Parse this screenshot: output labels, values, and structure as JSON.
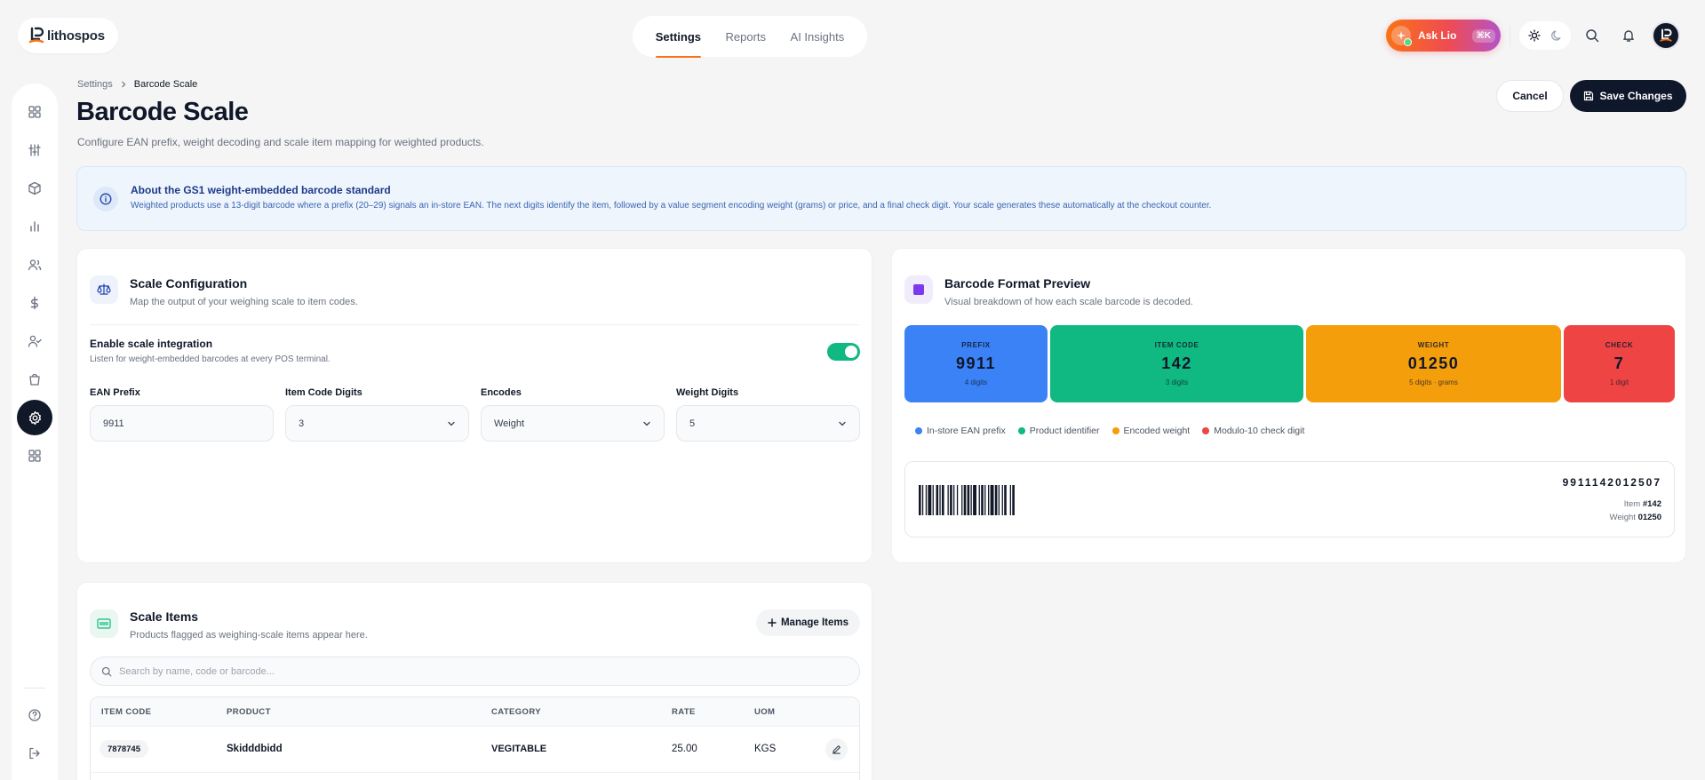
{
  "brand": {
    "name": "lithospos"
  },
  "topnav": {
    "tabs": [
      {
        "label": "Settings"
      },
      {
        "label": "Reports"
      },
      {
        "label": "AI Insights"
      }
    ]
  },
  "topright": {
    "ask_label": "Ask Lio",
    "ask_shortcut": "⌘K"
  },
  "breadcrumb": {
    "parent": "Settings",
    "current": "Barcode Scale"
  },
  "page": {
    "title": "Barcode Scale",
    "subtitle": "Configure EAN prefix, weight decoding and scale item mapping for weighted products.",
    "cancel_label": "Cancel",
    "save_label": "Save Changes"
  },
  "banner": {
    "title": "About the GS1 weight-embedded barcode standard",
    "text": "Weighted products use a 13-digit barcode where a prefix (20–29) signals an in-store EAN. The next digits identify the item, followed by a value segment encoding weight (grams) or price, and a final check digit. Your scale generates these automatically at the checkout counter."
  },
  "scale_config": {
    "title": "Scale Configuration",
    "subtitle": "Map the output of your weighing scale to item codes.",
    "toggle_title": "Enable scale integration",
    "toggle_sub": "Listen for weight-embedded barcodes at every POS terminal.",
    "toggle_on": true,
    "fields": {
      "ean_prefix": {
        "label": "EAN Prefix",
        "value": "9911"
      },
      "item_code_digits": {
        "label": "Item Code Digits",
        "value": "3"
      },
      "encodes": {
        "label": "Encodes",
        "value": "Weight"
      },
      "weight_digits": {
        "label": "Weight Digits",
        "value": "5"
      }
    }
  },
  "preview": {
    "title": "Barcode Format Preview",
    "subtitle": "Visual breakdown of how each scale barcode is decoded.",
    "segments": [
      {
        "label": "PREFIX",
        "value": "9911",
        "desc": "4 digits",
        "color": "#3b82f6"
      },
      {
        "label": "ITEM CODE",
        "value": "142",
        "desc": "3 digits",
        "color": "#10b981"
      },
      {
        "label": "WEIGHT",
        "value": "01250",
        "desc": "5 digits · grams",
        "color": "#f59e0b"
      },
      {
        "label": "CHECK",
        "value": "7",
        "desc": "1 digit",
        "color": "#ef4444"
      }
    ],
    "legend": [
      {
        "label": "In-store EAN prefix",
        "color": "#3b82f6"
      },
      {
        "label": "Product identifier",
        "color": "#10b981"
      },
      {
        "label": "Encoded weight",
        "color": "#f59e0b"
      },
      {
        "label": "Modulo-10 check digit",
        "color": "#ef4444"
      }
    ],
    "barcode_number": "9911142012507",
    "item_label": "Item",
    "item_value": "#142",
    "weight_label": "Weight",
    "weight_value": "01250"
  },
  "scale_items": {
    "title": "Scale Items",
    "subtitle": "Products flagged as weighing-scale items appear here.",
    "manage_label": "Manage Items",
    "search_placeholder": "Search by name, code or barcode...",
    "columns": [
      "ITEM CODE",
      "PRODUCT",
      "CATEGORY",
      "RATE",
      "UOM"
    ],
    "rows": [
      {
        "code": "7878745",
        "product": "Skidddbidd",
        "category": "VEGITABLE",
        "rate": "25.00",
        "uom": "KGS"
      }
    ]
  }
}
